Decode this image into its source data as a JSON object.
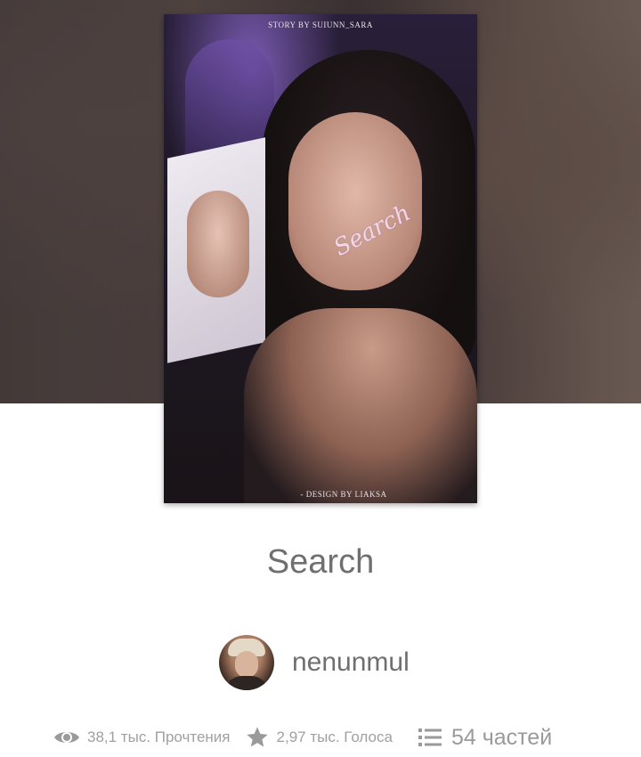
{
  "cover": {
    "top_credit": "STORY BY SUIUNN_SARA",
    "script_title": "Search",
    "bottom_credit": "- DESIGN BY LIAKSA"
  },
  "story": {
    "title": "Search"
  },
  "author": {
    "name": "nenunmul"
  },
  "stats": {
    "reads": "38,1 тыс. Прочтения",
    "votes": "2,97 тыс. Голоса",
    "parts": "54 частей"
  },
  "icons": {
    "reads": "eye-icon",
    "votes": "star-icon",
    "parts": "list-icon"
  }
}
